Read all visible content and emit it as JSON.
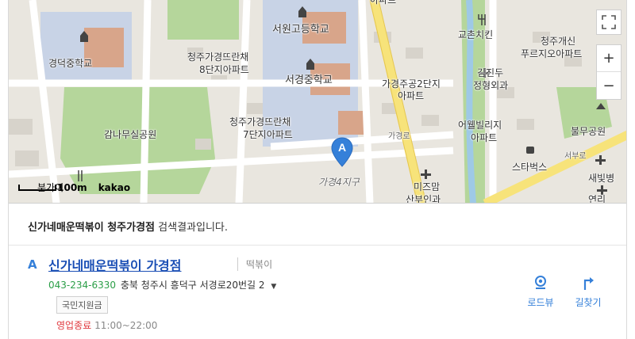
{
  "map": {
    "labels": {
      "school_gyeongdeok": "경덕중학교",
      "school_seowon": "서원고등학교",
      "school_seogyeong": "서경중학교",
      "apt8_line1": "청주가경뜨란채",
      "apt8_line2": "8단지아파트",
      "apt7_line1": "청주가경뜨란채",
      "apt7_line2": "7단지아파트",
      "park_ganmau": "감나무실공원",
      "apt_jugong_line1": "가경주공2단지",
      "apt_jugong_line2": "아파트",
      "kyochon": "교촌치킨",
      "prugio_line1": "청주개신",
      "prugio_line2": "푸르지오아파트",
      "kimjindu_line1": "김진두",
      "kimjindu_line2": "정형외과",
      "uwell_line1": "어웰빌리지",
      "uwell_line2": "아파트",
      "park_bulmu": "불무공원",
      "starbucks": "스타벅스",
      "saebyeol": "새빛병",
      "mizmom_line1": "미즈맘",
      "mizmom_line2": "산부인과",
      "gagyeong4": "가경4지구",
      "gagyeongro": "가경로",
      "seobuero": "서부로",
      "top_text": "아파트",
      "bottom_right": "연리"
    },
    "marker_letter": "A",
    "scale_label": "100m",
    "scale_overlap": "분가이",
    "brand": "kakao",
    "controls": {
      "fullscreen_icon": "expand-icon",
      "zoom_in": "+",
      "zoom_out": "−"
    }
  },
  "summary": {
    "query": "신가네매운떡볶이 청주가경점",
    "suffix": " 검색결과입니다."
  },
  "result": {
    "letter": "A",
    "title": "신가네매운떡볶이 가경점",
    "category": "떡볶이",
    "phone": "043-234-6330",
    "address": "충북 청주시 흥덕구 서경로20번길 2",
    "address_toggle": "▼",
    "tag": "국민지원금",
    "status": "영업종료",
    "hours": "11:00~22:00",
    "actions": {
      "roadview": "로드뷰",
      "route": "길찾기"
    }
  },
  "colors": {
    "accent": "#3580d9",
    "title": "#1b4fb5",
    "phone": "#2b9e47",
    "closed": "#e0393e",
    "park": "#b5d69b",
    "school": "#c8d3e6",
    "road": "#ffffff",
    "main_road": "#f7e37a"
  }
}
